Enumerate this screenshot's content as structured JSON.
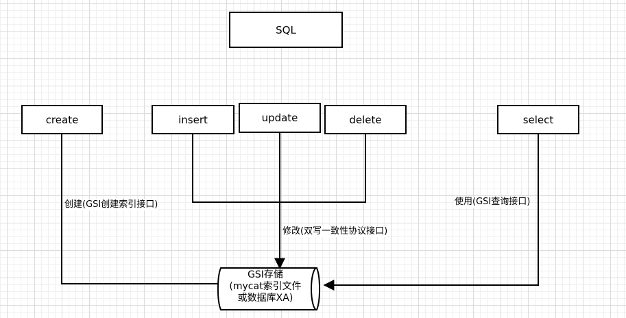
{
  "nodes": {
    "sql": "SQL",
    "create": "create",
    "insert": "insert",
    "update": "update",
    "delete": "delete",
    "select": "select"
  },
  "storage": {
    "line1": "GSI存储",
    "line2": "(mycat索引文件",
    "line3": "或数据库XA)"
  },
  "edges": {
    "create_label": "创建(GSI创建索引接口)",
    "modify_label": "修改(双写一致性协议接口)",
    "select_label": "使用(GSI查询接口)"
  }
}
